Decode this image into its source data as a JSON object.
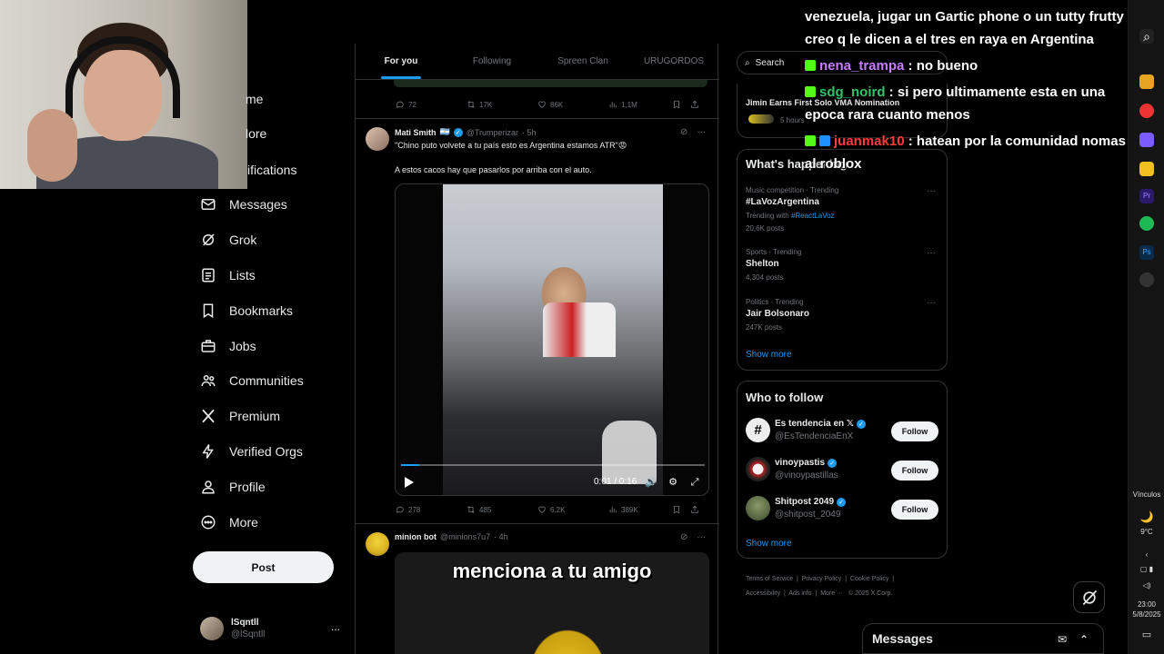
{
  "nav": {
    "items": [
      {
        "label": "Home",
        "display": "me"
      },
      {
        "label": "Explore",
        "display": "lore"
      },
      {
        "label": "Notifications",
        "display": "ifications"
      },
      {
        "label": "Messages"
      },
      {
        "label": "Grok"
      },
      {
        "label": "Lists"
      },
      {
        "label": "Bookmarks"
      },
      {
        "label": "Jobs"
      },
      {
        "label": "Communities"
      },
      {
        "label": "Premium"
      },
      {
        "label": "Verified Orgs"
      },
      {
        "label": "Profile"
      },
      {
        "label": "More"
      }
    ],
    "post_label": "Post",
    "account_name": "lSqntll",
    "account_handle": "@lSqntll",
    "account_more": "..."
  },
  "feed": {
    "tabs": [
      "For you",
      "Following",
      "Spreen Clan",
      "URUGORDOS"
    ],
    "prev_actions": {
      "replies": "72",
      "reposts": "17K",
      "likes": "86K",
      "views": "1,1M"
    },
    "tweet1": {
      "name": "Mati Smith",
      "flag": "🇦🇷",
      "handle": "@Trumperizar",
      "time": "· 5h",
      "text1": "\"Chino puto volvete a tu país esto es Argentina estamos ATR\"😡",
      "text2": "A estos cacos hay que pasarlos por arriba con el auto.",
      "video_time": "0:01 / 0:16",
      "video_progress": 0.06,
      "replies": "278",
      "reposts": "485",
      "likes": "6,2K",
      "views": "389K"
    },
    "tweet2": {
      "name": "minion bot",
      "handle": "@minions7u7",
      "time": "· 4h",
      "image_caption": "menciona a tu amigo"
    }
  },
  "right": {
    "search_placeholder": "Search",
    "news_title": "Jimin Earns First Solo VMA Nomination",
    "news_meta": "5 hours",
    "happening_title": "What's happening",
    "trends": [
      {
        "meta": "Music competition · Trending",
        "name": "#LaVozArgentina",
        "extra_prefix": "Trending with ",
        "extra_link": "#ReactLaVoz",
        "posts": "20,6K posts"
      },
      {
        "meta": "Sports · Trending",
        "name": "Shelton",
        "posts": "4,304 posts"
      },
      {
        "meta": "Politics · Trending",
        "name": "Jair Bolsonaro",
        "posts": "247K posts"
      }
    ],
    "show_more": "Show more",
    "who_title": "Who to follow",
    "who": [
      {
        "name": "Es tendencia en 𝕏",
        "handle": "@EsTendenciaEnX",
        "follow": "Follow"
      },
      {
        "name": "vinoypastis",
        "handle": "@vinoypastillas",
        "follow": "Follow"
      },
      {
        "name": "Shitpost 2049",
        "handle": "@shitpost_2049",
        "follow": "Follow"
      }
    ],
    "who_show_more": "Show more",
    "footer": [
      "Terms of Service",
      "Privacy Policy",
      "Cookie Policy",
      "Accessibility",
      "Ads info",
      "More ···",
      "© 2025 X Corp."
    ],
    "messages_label": "Messages"
  },
  "chat": [
    {
      "text": "venezuela, jugar un Gartic phone o un tutty frutty q"
    },
    {
      "text": "creo q le dicen a el tres en raya en Argentina"
    },
    {
      "user": "nena_trampa",
      "color": "#c77dff",
      "badge": "#53fc18",
      "text": " : no bueno"
    },
    {
      "user": "sdg_noird",
      "color": "#35c26a",
      "badge": "#53fc18",
      "text": " : si pero ultimamente esta en una"
    },
    {
      "text": "epoca rara cuanto menos"
    },
    {
      "user": "juanmak10",
      "color": "#ff3b3b",
      "badge": "#53fc18",
      "badge2": "#1e90ff",
      "text": " : hatean por la comunidad nomas"
    },
    {
      "text": "al roblox"
    }
  ],
  "taskbar": {
    "links_label": "Vínculos",
    "temp": "9°C",
    "time": "23:00",
    "date": "5/8/2025"
  },
  "colors": {
    "accent": "#1d9bf0",
    "bg": "#000000",
    "muted": "#71767b"
  }
}
